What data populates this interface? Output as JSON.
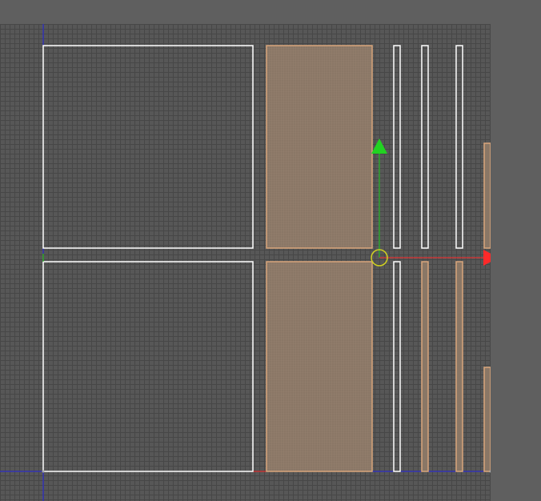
{
  "viewport": {
    "background": "#575757",
    "grid_color": "#474747"
  },
  "colors": {
    "uv_outline_unselected": "#ffffff",
    "uv_face_selected_fill": "#8a7766",
    "uv_face_selected_edge": "#d9a57c",
    "axis_x": "#ff2a2a",
    "axis_y": "#22d322",
    "axis_blue": "#2a2ae8",
    "pivot": "#d0d020"
  },
  "gizmo": {
    "y_arrow_icon": "triangle-up",
    "x_arrow_icon": "triangle-right",
    "pivot_icon": "circle"
  },
  "uv_islands": [
    {
      "id": "square-top-left",
      "selected": false
    },
    {
      "id": "square-bottom-left",
      "selected": false
    },
    {
      "id": "strip-top-selected",
      "selected": true
    },
    {
      "id": "strip-bottom-selected",
      "selected": true
    },
    {
      "id": "thin-top-1",
      "selected": false
    },
    {
      "id": "thin-top-2",
      "selected": false
    },
    {
      "id": "thin-top-3",
      "selected": false
    },
    {
      "id": "thin-right-upper",
      "selected": true
    },
    {
      "id": "thin-bottom-1",
      "selected": false
    },
    {
      "id": "thin-bottom-2",
      "selected": true
    },
    {
      "id": "thin-bottom-3",
      "selected": true
    },
    {
      "id": "thin-right-lower",
      "selected": true
    }
  ]
}
